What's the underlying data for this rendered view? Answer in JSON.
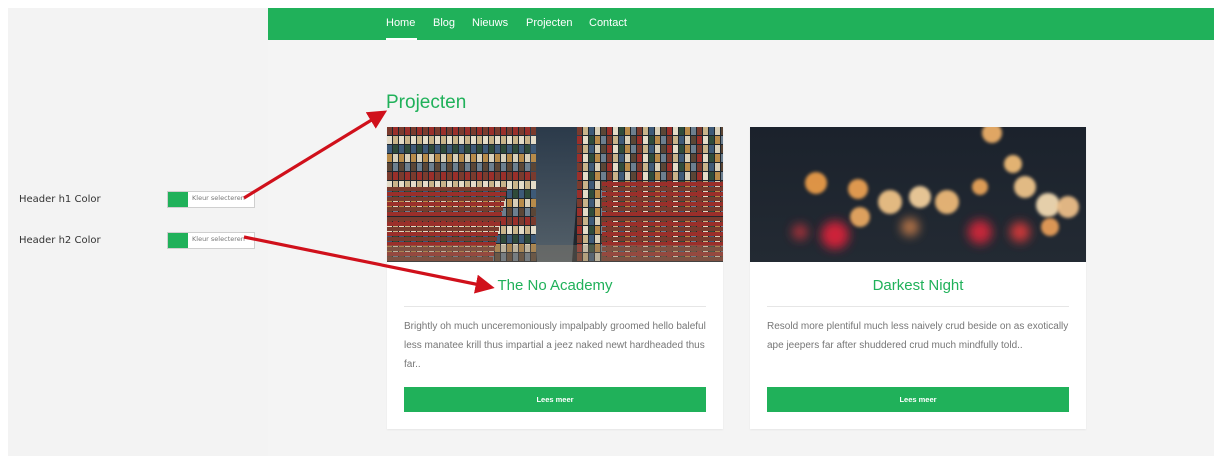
{
  "colors": {
    "brand_green": "#20b15a",
    "arrow_red": "#d0101b"
  },
  "settings": {
    "items": [
      {
        "label": "Header h1 Color",
        "button_text": "Kleur selecteren"
      },
      {
        "label": "Header h2 Color",
        "button_text": "Kleur selecteren"
      }
    ]
  },
  "nav": {
    "items": [
      "Home",
      "Blog",
      "Nieuws",
      "Projecten",
      "Contact"
    ],
    "active": "Home"
  },
  "page": {
    "title": "Projecten"
  },
  "cards": [
    {
      "title": "The No Academy",
      "image_icon": "bookshelf-photo",
      "text": "Brightly oh much unceremoniously impalpably groomed hello baleful less manatee krill thus impartial a jeez naked newt hardheaded thus far..",
      "button": "Lees meer"
    },
    {
      "title": "Darkest Night",
      "image_icon": "bokeh-lights-photo",
      "text": "Resold more plentiful much less naively crud beside on as exotically ape jeepers far after shuddered crud much mindfully told..",
      "button": "Lees meer"
    }
  ]
}
